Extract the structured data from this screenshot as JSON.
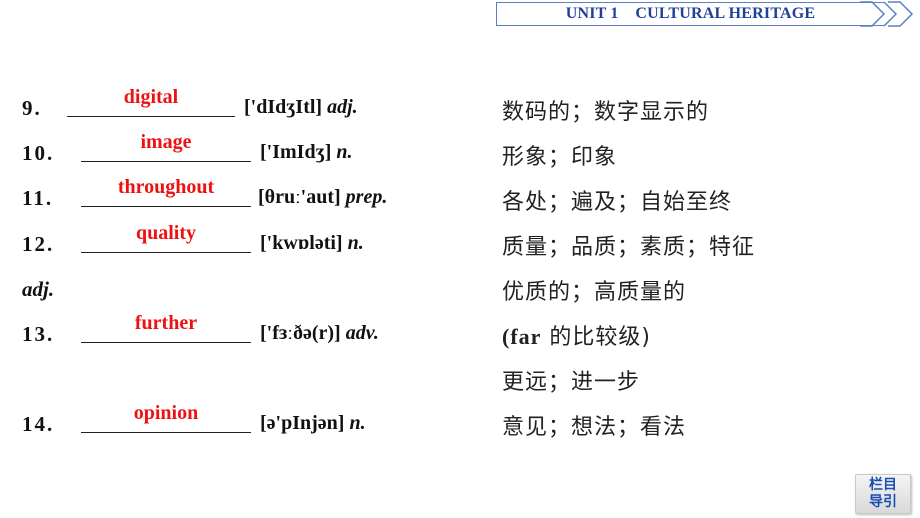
{
  "header": {
    "title": "UNIT 1    CULTURAL HERITAGE",
    "border_color": "#5b7fc4",
    "text_color": "#1f3f9a"
  },
  "answer_color": "#ee1111",
  "items": [
    {
      "num": "9.",
      "answer": "digital",
      "phonetic": "['dIdʒItl]",
      "pos": "adj.",
      "meaning": "数码的；数字显示的"
    },
    {
      "num": "10.",
      "answer": "image",
      "phonetic": "['ImIdʒ]",
      "pos": "n.",
      "meaning": "形象；印象"
    },
    {
      "num": "11.",
      "answer": "throughout",
      "phonetic": "[θruː'aut]",
      "pos": "prep.",
      "meaning": "各处；遍及；自始至终"
    },
    {
      "num": "12.",
      "answer": "quality",
      "phonetic": "['kwɒləti]",
      "pos": "n.",
      "meaning": "质量；品质；素质；特征"
    },
    {
      "pos_extra": "adj.",
      "meaning": "优质的；高质量的"
    },
    {
      "num": "13.",
      "answer": "further",
      "phonetic": "['fɜːðə(r)]",
      "pos": "adv.",
      "meaning_prefix": "(far",
      "meaning": " 的比较级)",
      "meaning2": "更远；进一步"
    },
    {
      "num": "14.",
      "answer": "opinion",
      "phonetic": "[ə'pInjən]",
      "pos": "n.",
      "meaning": "意见；想法；看法"
    }
  ],
  "nav_button": {
    "line1": "栏目",
    "line2": "导引"
  }
}
